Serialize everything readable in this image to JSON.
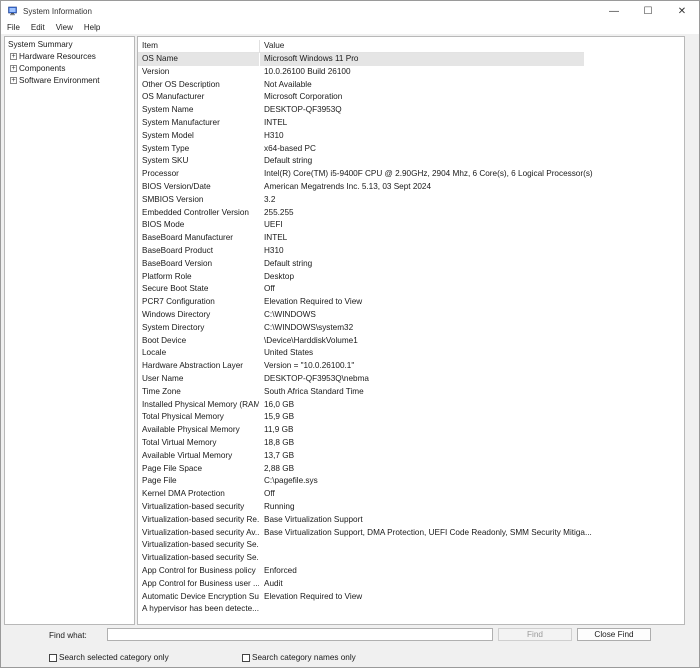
{
  "window": {
    "title": "System Information",
    "controls": [
      "—",
      "☐",
      "✕"
    ]
  },
  "menu": [
    "File",
    "Edit",
    "View",
    "Help"
  ],
  "tree": {
    "root": "System Summary",
    "children": [
      "Hardware Resources",
      "Components",
      "Software Environment"
    ],
    "expander": "+"
  },
  "table": {
    "headers": [
      "Item",
      "Value"
    ],
    "rows": [
      [
        "OS Name",
        "Microsoft Windows 11 Pro"
      ],
      [
        "Version",
        "10.0.26100 Build 26100"
      ],
      [
        "Other OS Description",
        "Not Available"
      ],
      [
        "OS Manufacturer",
        "Microsoft Corporation"
      ],
      [
        "System Name",
        "DESKTOP-QF3953Q"
      ],
      [
        "System Manufacturer",
        "INTEL"
      ],
      [
        "System Model",
        "H310"
      ],
      [
        "System Type",
        "x64-based PC"
      ],
      [
        "System SKU",
        "Default string"
      ],
      [
        "Processor",
        "Intel(R) Core(TM) i5-9400F CPU @ 2.90GHz, 2904 Mhz, 6 Core(s), 6 Logical Processor(s)"
      ],
      [
        "BIOS Version/Date",
        "American Megatrends Inc. 5.13, 03 Sept 2024"
      ],
      [
        "SMBIOS Version",
        "3.2"
      ],
      [
        "Embedded Controller Version",
        "255.255"
      ],
      [
        "BIOS Mode",
        "UEFI"
      ],
      [
        "BaseBoard Manufacturer",
        "INTEL"
      ],
      [
        "BaseBoard Product",
        "H310"
      ],
      [
        "BaseBoard Version",
        "Default string"
      ],
      [
        "Platform Role",
        "Desktop"
      ],
      [
        "Secure Boot State",
        "Off"
      ],
      [
        "PCR7 Configuration",
        "Elevation Required to View"
      ],
      [
        "Windows Directory",
        "C:\\WINDOWS"
      ],
      [
        "System Directory",
        "C:\\WINDOWS\\system32"
      ],
      [
        "Boot Device",
        "\\Device\\HarddiskVolume1"
      ],
      [
        "Locale",
        "United States"
      ],
      [
        "Hardware Abstraction Layer",
        "Version = \"10.0.26100.1\""
      ],
      [
        "User Name",
        "DESKTOP-QF3953Q\\nebma"
      ],
      [
        "Time Zone",
        "South Africa Standard Time"
      ],
      [
        "Installed Physical Memory (RAM)",
        "16,0 GB"
      ],
      [
        "Total Physical Memory",
        "15,9 GB"
      ],
      [
        "Available Physical Memory",
        "11,9 GB"
      ],
      [
        "Total Virtual Memory",
        "18,8 GB"
      ],
      [
        "Available Virtual Memory",
        "13,7 GB"
      ],
      [
        "Page File Space",
        "2,88 GB"
      ],
      [
        "Page File",
        "C:\\pagefile.sys"
      ],
      [
        "Kernel DMA Protection",
        "Off"
      ],
      [
        "Virtualization-based security",
        "Running"
      ],
      [
        "Virtualization-based security Re...",
        "Base Virtualization Support"
      ],
      [
        "Virtualization-based security Av...",
        "Base Virtualization Support, DMA Protection, UEFI Code Readonly, SMM Security Mitiga..."
      ],
      [
        "Virtualization-based security Se...",
        ""
      ],
      [
        "Virtualization-based security Se...",
        ""
      ],
      [
        "App Control for Business policy",
        "Enforced"
      ],
      [
        "App Control for Business user ...",
        "Audit"
      ],
      [
        "Automatic Device Encryption Su...",
        "Elevation Required to View"
      ],
      [
        "A hypervisor has been detecte...",
        ""
      ]
    ]
  },
  "find": {
    "label": "Find what:",
    "input_value": "",
    "find_button": "Find",
    "close_button": "Close Find",
    "check_selected": "Search selected category only",
    "check_names": "Search category names only"
  }
}
